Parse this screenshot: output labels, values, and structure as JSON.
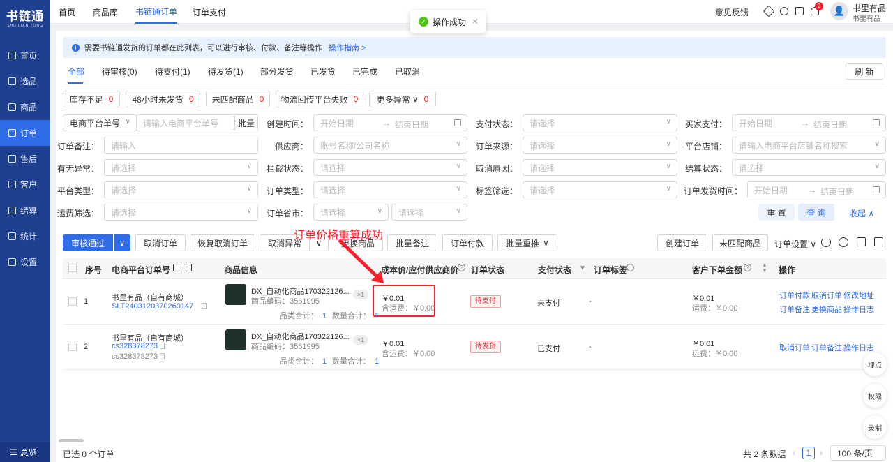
{
  "app": {
    "logo": "书链通",
    "logo_sub": "SHU LIAN TONG"
  },
  "sidebar": {
    "items": [
      {
        "label": "首页"
      },
      {
        "label": "选品"
      },
      {
        "label": "商品"
      },
      {
        "label": "订单"
      },
      {
        "label": "售后"
      },
      {
        "label": "客户"
      },
      {
        "label": "结算"
      },
      {
        "label": "统计"
      },
      {
        "label": "设置"
      }
    ],
    "bottom": "总览"
  },
  "topnav": [
    "首页",
    "商品库",
    "书链通订单",
    "订单支付"
  ],
  "topright": {
    "feedback": "意见反馈",
    "badge": "2",
    "user": "书里有品",
    "user_sub": "书里有品"
  },
  "toast": {
    "text": "操作成功"
  },
  "info": {
    "text": "需要书链通发货的订单都在此列表，可以进行审核、付款、备注等操作",
    "link": "操作指南 >"
  },
  "tabs": [
    "全部",
    "待审核(0)",
    "待支付(1)",
    "待发货(1)",
    "部分发货",
    "已发货",
    "已完成",
    "已取消"
  ],
  "refresh": "刷 新",
  "chips": [
    {
      "label": "库存不足",
      "count": "0"
    },
    {
      "label": "48小时未发货",
      "count": "0"
    },
    {
      "label": "未匹配商品",
      "count": "0"
    },
    {
      "label": "物流回传平台失败",
      "count": "0"
    },
    {
      "label": "更多异常",
      "count": "0"
    }
  ],
  "filters": {
    "order_no_type": "电商平台单号",
    "order_no_ph": "请输入电商平台单号",
    "batch": "批量",
    "create_time": "创建时间：",
    "pay_status": "支付状态：",
    "buyer_pay": "买家支付：",
    "start_date": "开始日期",
    "end_date": "结束日期",
    "remark": "订单备注：",
    "remark_ph": "请输入",
    "supplier": "供应商：",
    "supplier_ph": "账号名称/公司名称",
    "source": "订单来源：",
    "shop": "平台店铺：",
    "shop_ph": "请输入电商平台店铺名称搜索",
    "abnormal": "有无异常：",
    "intercept": "拦截状态：",
    "cancel_reason": "取消原因：",
    "settle": "结算状态：",
    "platform_type": "平台类型：",
    "order_type": "订单类型：",
    "tag_filter": "标签筛选：",
    "ship_time": "订单发货时间：",
    "freight": "运费筛选：",
    "province": "订单省市：",
    "select_ph": "请选择",
    "reset": "重 置",
    "query": "查 询",
    "collapse": "收起"
  },
  "actions": {
    "approve": "审核通过",
    "cancel": "取消订单",
    "restore": "恢复取消订单",
    "cancel_abn": "取消异常",
    "replace": "更换商品",
    "batch_remark": "批量备注",
    "pay": "订单付款",
    "batch_push": "批量重推",
    "create": "创建订单",
    "unmatched": "未匹配商品",
    "settings": "订单设置"
  },
  "annotation": "订单价格重算成功",
  "columns": [
    "序号",
    "电商平台订单号",
    "商品信息",
    "成本价/应付供应商价",
    "订单状态",
    "支付状态",
    "订单标签",
    "客户下单金额",
    "操作"
  ],
  "rows": [
    {
      "idx": "1",
      "shop": "书里有品（自有商城）",
      "order_no": "SLT2403120370260147",
      "order_no2": "",
      "product": "DX_自动化商品170322126...",
      "code": "商品编码：3561995",
      "qty": "×1",
      "kinds": "品类合计：",
      "kinds_n": "1",
      "count": "数量合计：",
      "count_n": "1",
      "price": "￥0.01",
      "freight": "含运费：￥0.00",
      "status": "待支付",
      "pay": "未支付",
      "tag": "-",
      "amount": "￥0.01",
      "amount_freight": "运费：￥0.00",
      "ops": [
        "订单付款",
        "取消订单",
        "修改地址",
        "订单备注",
        "更换商品",
        "操作日志"
      ]
    },
    {
      "idx": "2",
      "shop": "书里有品（自有商城）",
      "order_no": "cs328378273",
      "order_no2": "cs328378273",
      "product": "DX_自动化商品170322126...",
      "code": "商品编码：3561995",
      "qty": "×1",
      "kinds": "品类合计：",
      "kinds_n": "1",
      "count": "数量合计：",
      "count_n": "1",
      "price": "￥0.01",
      "freight": "含运费：￥0.00",
      "status": "待发货",
      "pay": "已支付",
      "tag": "-",
      "amount": "￥0.01",
      "amount_freight": "运费：￥0.00",
      "ops": [
        "取消订单",
        "订单备注",
        "操作日志"
      ]
    }
  ],
  "floats": [
    "埋点",
    "权限",
    "录制"
  ],
  "footer": {
    "selected": "已选  0  个订单",
    "total": "共 2 条数据",
    "page": "1",
    "page_size": "100 条/页"
  }
}
